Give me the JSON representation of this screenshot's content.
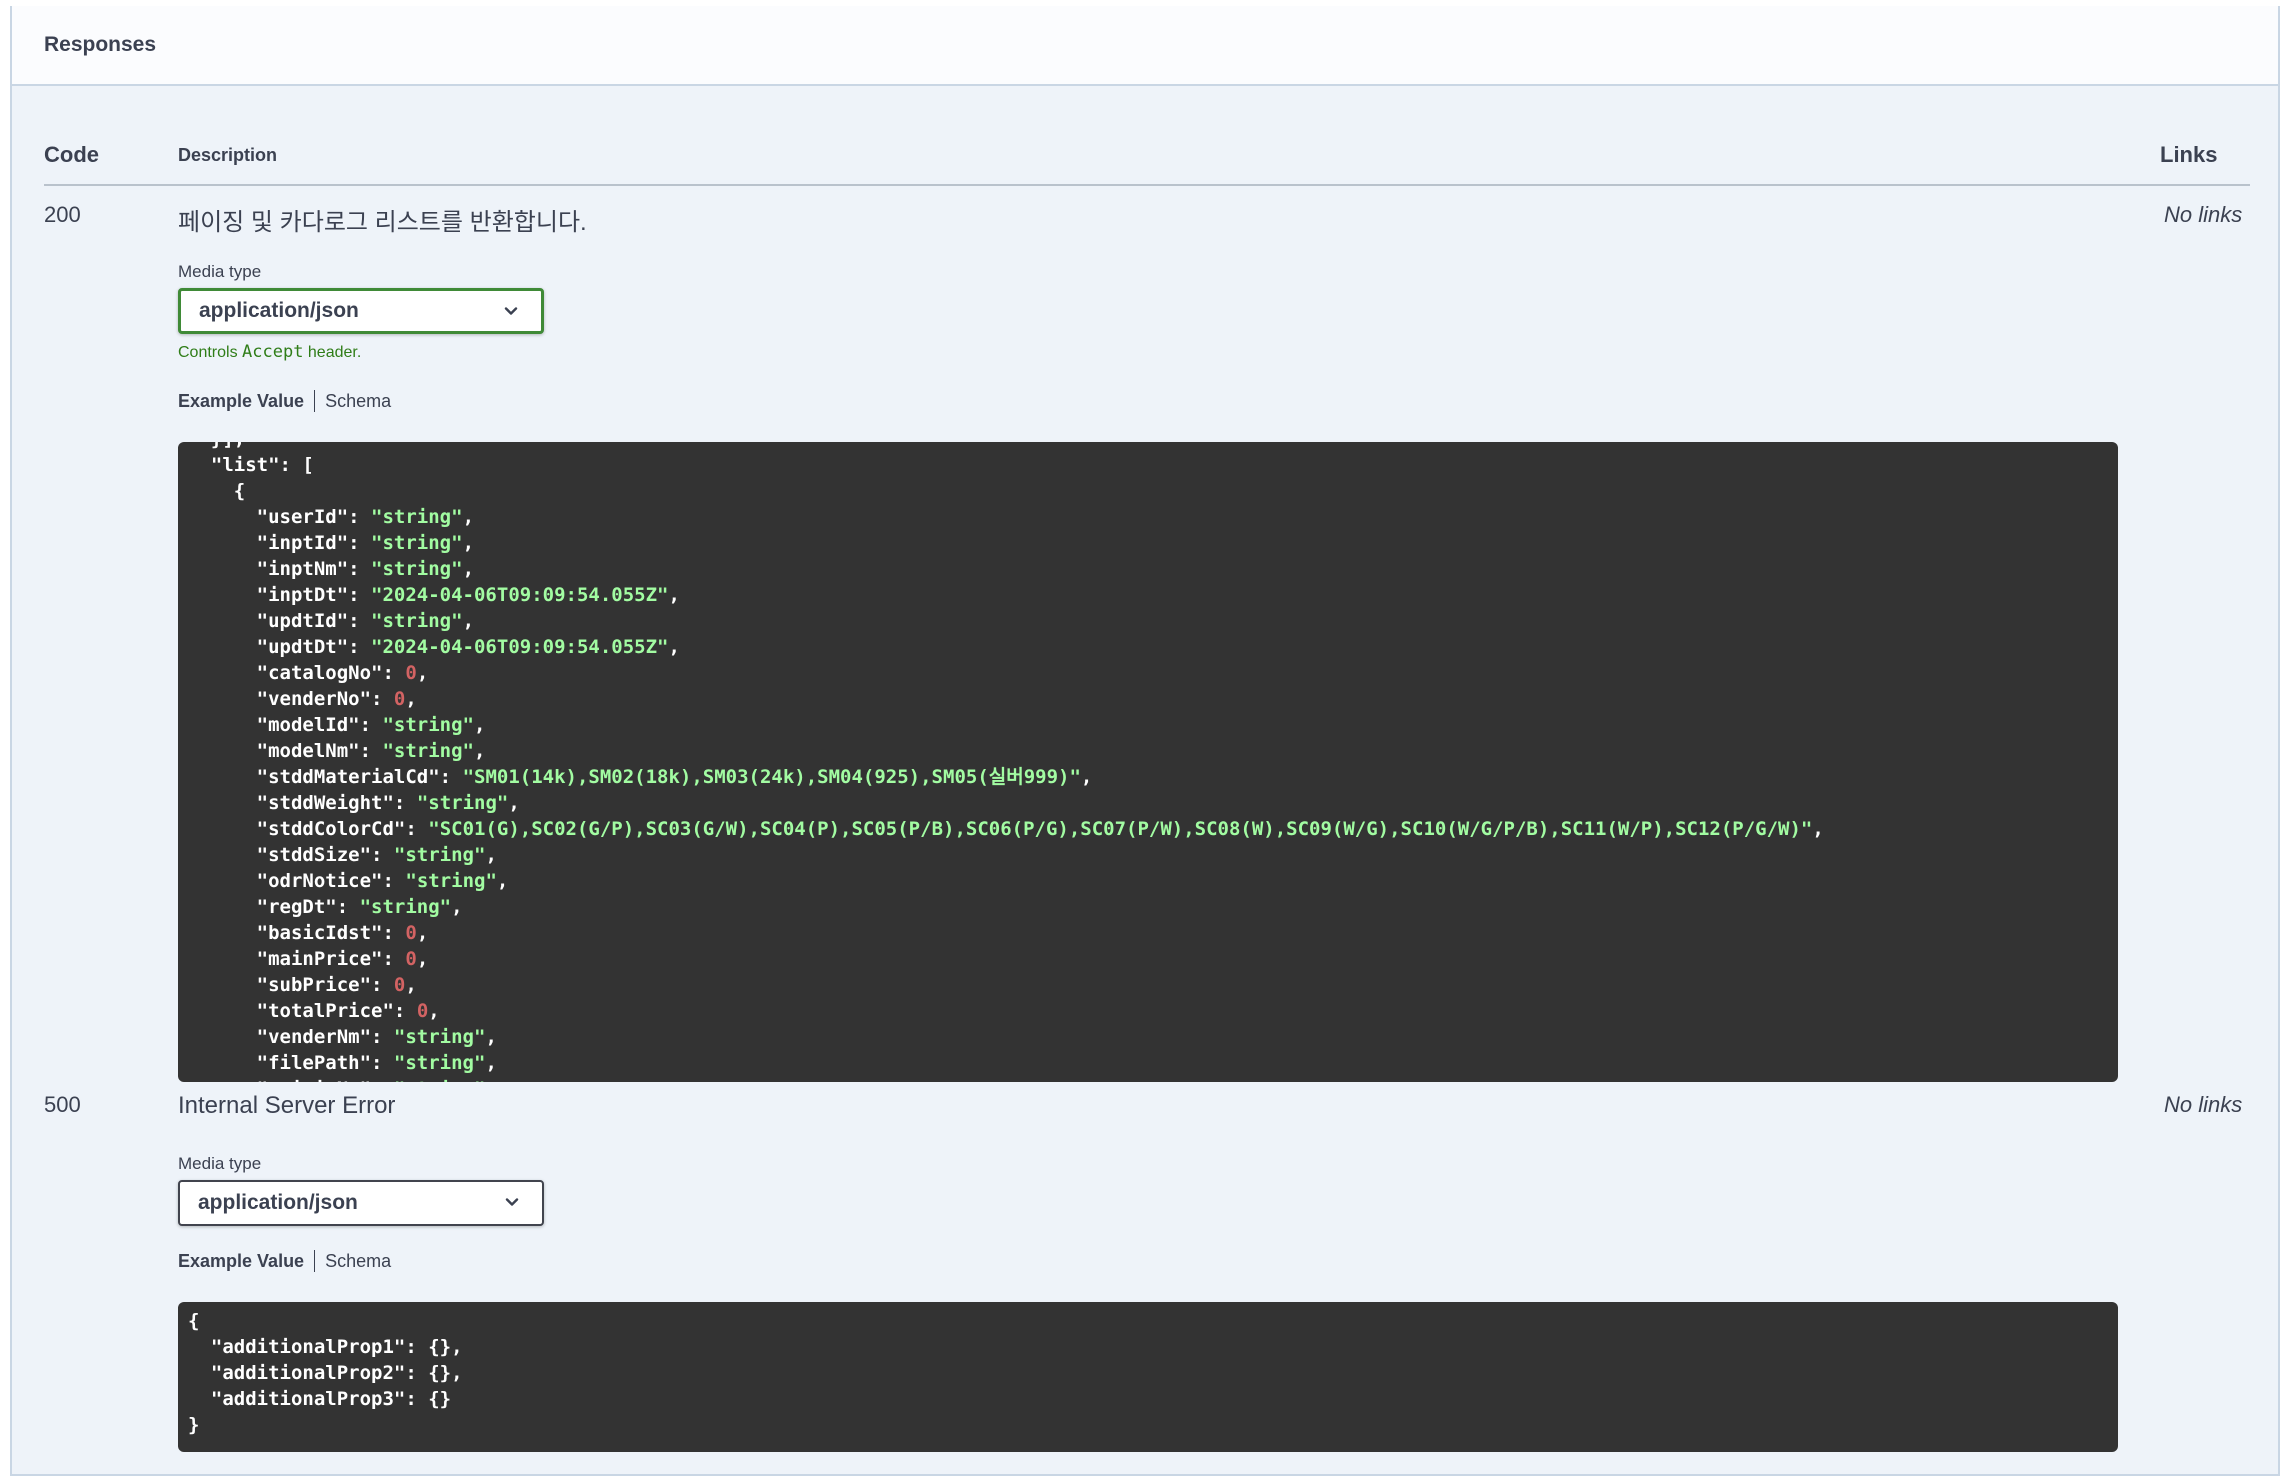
{
  "section_title": "Responses",
  "columns": {
    "code": "Code",
    "description": "Description",
    "links": "Links"
  },
  "responses": [
    {
      "code": "200",
      "description": "페이징 및 카다로그 리스트를 반환합니다.",
      "links": "No links",
      "media_type_label": "Media type",
      "media_type_value": "application/json",
      "controls_prefix": "Controls ",
      "controls_code": "Accept",
      "controls_suffix": " header.",
      "tab_example": "Example Value",
      "tab_schema": "Schema",
      "example_lines_text": [
        "  }],",
        "  \"list\": [",
        "    {",
        "      \"userId\": \"string\",",
        "      \"inptId\": \"string\",",
        "      \"inptNm\": \"string\",",
        "      \"inptDt\": \"2024-04-06T09:09:54.055Z\",",
        "      \"updtId\": \"string\",",
        "      \"updtDt\": \"2024-04-06T09:09:54.055Z\",",
        "      \"catalogNo\": 0,",
        "      \"venderNo\": 0,",
        "      \"modelId\": \"string\",",
        "      \"modelNm\": \"string\",",
        "      \"stddMaterialCd\": \"SM01(14k),SM02(18k),SM03(24k),SM04(925),SM05(실버999)\",",
        "      \"stddWeight\": \"string\",",
        "      \"stddColorCd\": \"SC01(G),SC02(G/P),SC03(G/W),SC04(P),SC05(P/B),SC06(P/G),SC07(P/W),SC08(W),SC09(W/G),SC10(W/G/P/B),SC11(W/P),SC12(P/G/W)\",",
        "      \"stddSize\": \"string\",",
        "      \"odrNotice\": \"string\",",
        "      \"regDt\": \"string\",",
        "      \"basicIdst\": 0,",
        "      \"mainPrice\": 0,",
        "      \"subPrice\": 0,",
        "      \"totalPrice\": 0,",
        "      \"venderNm\": \"string\",",
        "      \"filePath\": \"string\",",
        "      \"originNm\": \"string\","
      ]
    },
    {
      "code": "500",
      "description": "Internal Server Error",
      "links": "No links",
      "media_type_label": "Media type",
      "media_type_value": "application/json",
      "tab_example": "Example Value",
      "tab_schema": "Schema",
      "example_lines_text": [
        "{",
        "  \"additionalProp1\": {},",
        "  \"additionalProp2\": {},",
        "  \"additionalProp3\": {}",
        "}"
      ]
    }
  ],
  "colors": {
    "string_value": "#a2fca2",
    "number_value": "#d36363",
    "code_bg": "#333333",
    "active_select_border": "#3f8a37",
    "hint_text": "#2f7d18"
  },
  "icons": {
    "select_arrow": "chevron-down-icon"
  }
}
